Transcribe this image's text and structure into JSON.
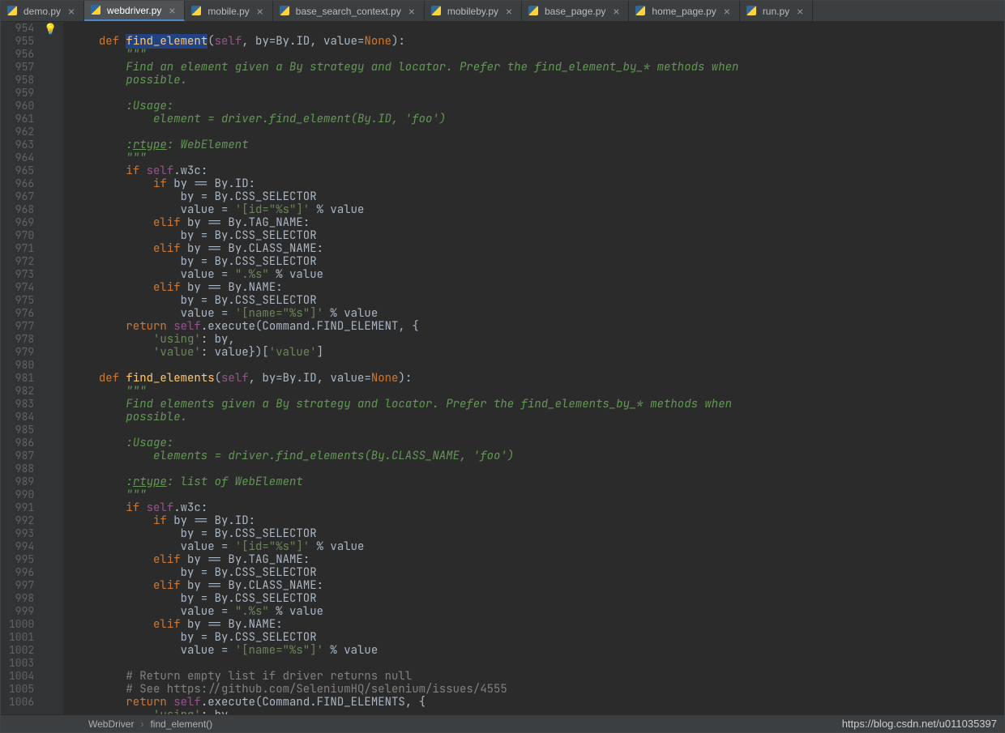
{
  "tabs": [
    {
      "label": "demo.py",
      "active": false
    },
    {
      "label": "webdriver.py",
      "active": true
    },
    {
      "label": "mobile.py",
      "active": false
    },
    {
      "label": "base_search_context.py",
      "active": false
    },
    {
      "label": "mobileby.py",
      "active": false
    },
    {
      "label": "base_page.py",
      "active": false
    },
    {
      "label": "home_page.py",
      "active": false
    },
    {
      "label": "run.py",
      "active": false
    }
  ],
  "gutter": {
    "start": 954,
    "end": 1006
  },
  "breadcrumb": {
    "class": "WebDriver",
    "method": "find_element()"
  },
  "watermark": "https://blog.csdn.net/u011035397",
  "code": {
    "l954": {
      "def": "def ",
      "fn": "find_element",
      "sig_open": "(",
      "self": "self",
      "c1": ", by=By.ID, value=",
      "none": "None",
      "sig_close": "):"
    },
    "l955": "        \"\"\"",
    "l956": "        Find an element given a By strategy and locator. Prefer the find_element_by_* methods when",
    "l957": "        possible.",
    "l958": "",
    "l959": "        :Usage:",
    "l960": "            element = driver.find_element(By.ID, 'foo')",
    "l961": "",
    "l962_a": "        :",
    "l962_rtype": "rtype",
    "l962_b": ": WebElement",
    "l963": "        \"\"\"",
    "l964_a": "        ",
    "l964_if": "if ",
    "l964_self": "self",
    "l964_b": ".w3c:",
    "l965_a": "            ",
    "l965_if": "if ",
    "l965_b": "by == By.ID:",
    "l966": "                by = By.CSS_SELECTOR",
    "l967_a": "                value = ",
    "l967_s": "'[id=\"%s\"]'",
    "l967_b": " % value",
    "l968_a": "            ",
    "l968_elif": "elif ",
    "l968_b": "by == By.TAG_NAME:",
    "l969": "                by = By.CSS_SELECTOR",
    "l970_a": "            ",
    "l970_elif": "elif ",
    "l970_b": "by == By.CLASS_NAME:",
    "l971": "                by = By.CSS_SELECTOR",
    "l972_a": "                value = ",
    "l972_s": "\".%s\"",
    "l972_b": " % value",
    "l973_a": "            ",
    "l973_elif": "elif ",
    "l973_b": "by == By.NAME:",
    "l974": "                by = By.CSS_SELECTOR",
    "l975_a": "                value = ",
    "l975_s": "'[name=\"%s\"]'",
    "l975_b": " % value",
    "l976_a": "        ",
    "l976_ret": "return ",
    "l976_self": "self",
    "l976_b": ".execute(Command.FIND_ELEMENT, {",
    "l977_a": "            ",
    "l977_s": "'using'",
    "l977_b": ": by,",
    "l978_a": "            ",
    "l978_s": "'value'",
    "l978_b": ": value})[",
    "l978_s2": "'value'",
    "l978_c": "]",
    "l979": "",
    "l980": {
      "def": "def ",
      "fn": "find_elements",
      "sig_open": "(",
      "self": "self",
      "c1": ", by=By.ID, value=",
      "none": "None",
      "sig_close": "):"
    },
    "l981": "        \"\"\"",
    "l982": "        Find elements given a By strategy and locator. Prefer the find_elements_by_* methods when",
    "l983": "        possible.",
    "l984": "",
    "l985": "        :Usage:",
    "l986": "            elements = driver.find_elements(By.CLASS_NAME, 'foo')",
    "l987": "",
    "l988_a": "        :",
    "l988_rtype": "rtype",
    "l988_b": ": list of WebElement",
    "l989": "        \"\"\"",
    "l990_a": "        ",
    "l990_if": "if ",
    "l990_self": "self",
    "l990_b": ".w3c:",
    "l991_a": "            ",
    "l991_if": "if ",
    "l991_b": "by == By.ID:",
    "l992": "                by = By.CSS_SELECTOR",
    "l993_a": "                value = ",
    "l993_s": "'[id=\"%s\"]'",
    "l993_b": " % value",
    "l994_a": "            ",
    "l994_elif": "elif ",
    "l994_b": "by == By.TAG_NAME:",
    "l995": "                by = By.CSS_SELECTOR",
    "l996_a": "            ",
    "l996_elif": "elif ",
    "l996_b": "by == By.CLASS_NAME:",
    "l997": "                by = By.CSS_SELECTOR",
    "l998_a": "                value = ",
    "l998_s": "\".%s\"",
    "l998_b": " % value",
    "l999_a": "            ",
    "l999_elif": "elif ",
    "l999_b": "by == By.NAME:",
    "l1000": "                by = By.CSS_SELECTOR",
    "l1001_a": "                value = ",
    "l1001_s": "'[name=\"%s\"]'",
    "l1001_b": " % value",
    "l1002": "",
    "l1003": "        # Return empty list if driver returns null",
    "l1004": "        # See https://github.com/SeleniumHQ/selenium/issues/4555",
    "l1005_a": "        ",
    "l1005_ret": "return ",
    "l1005_self": "self",
    "l1005_b": ".execute(Command.FIND_ELEMENTS, {",
    "l1006_a": "            ",
    "l1006_s": "'using'",
    "l1006_b": ": by,"
  }
}
